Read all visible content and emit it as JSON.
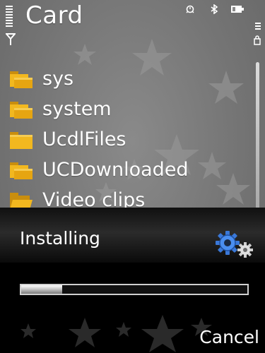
{
  "status_bar": {
    "title": "Card"
  },
  "file_list": {
    "items": [
      {
        "label": "sys",
        "icon": "folder-shared-icon"
      },
      {
        "label": "system",
        "icon": "folder-shared-icon"
      },
      {
        "label": "UcdlFiles",
        "icon": "folder-icon"
      },
      {
        "label": "UCDownloaded",
        "icon": "folder-shared-icon"
      },
      {
        "label": "Video clips",
        "icon": "folder-open-icon"
      }
    ]
  },
  "dialog": {
    "title": "Installing",
    "progress": 0.18,
    "icon": "gears-icon"
  },
  "softkeys": {
    "right_label": "Cancel"
  },
  "colors": {
    "folder": "#f2b81f",
    "folder_shade": "#c98e0e",
    "text": "#ffffff",
    "dialog_bg": "#000000",
    "gear_blue": "#3a78d8"
  }
}
